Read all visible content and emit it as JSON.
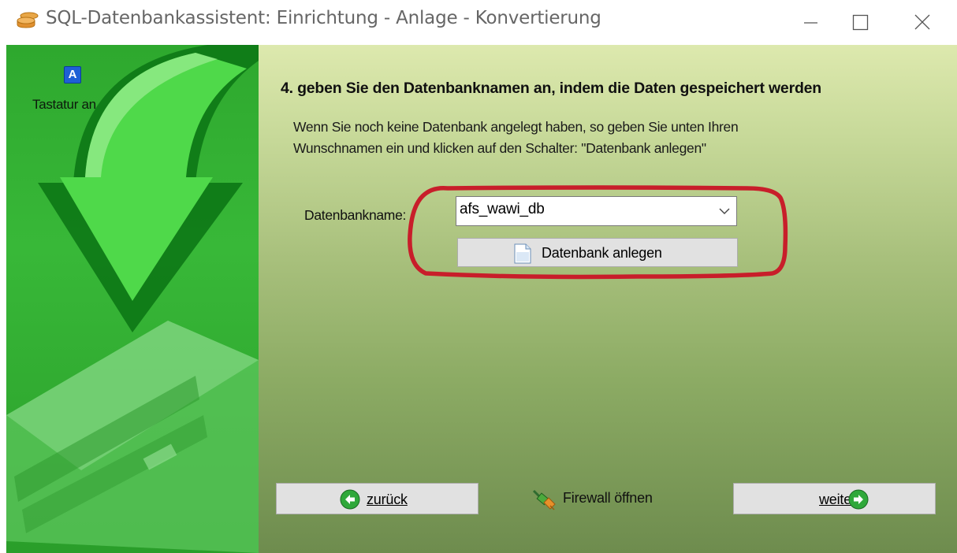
{
  "window": {
    "title": "SQL-Datenbankassistent:  Einrichtung - Anlage - Konvertierung",
    "controls": [
      "minimize-icon",
      "maximize-icon",
      "close-icon"
    ]
  },
  "sidebar": {
    "keyboard_icon_letter": "A",
    "keyboard_label": "Tastatur an"
  },
  "main": {
    "heading": "4. geben Sie den Datenbanknamen an, indem die Daten gespeichert werden",
    "description_line1": "Wenn Sie noch keine Datenbank angelegt haben, so geben Sie unten Ihren",
    "description_line2": "Wunschnamen ein und klicken auf den Schalter: \"Datenbank anlegen\"",
    "db_name_label": "Datenbankname:",
    "db_name_value": "afs_wawi_db",
    "create_button_label": "Datenbank anlegen"
  },
  "footer": {
    "back_label": "zurück",
    "firewall_label": "Firewall öffnen",
    "next_label": "weiter"
  },
  "colors": {
    "sidebar_green": "#2ea82e",
    "highlight_red": "#c81e2a",
    "button_face": "#e1e1e1"
  }
}
